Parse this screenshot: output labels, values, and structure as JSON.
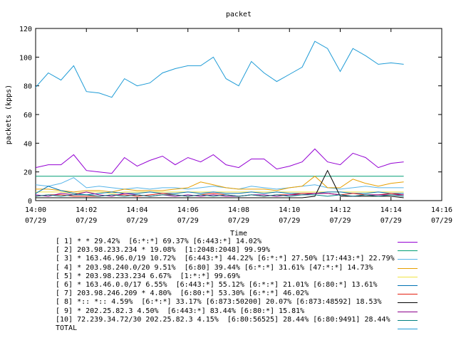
{
  "chart_data": {
    "type": "line",
    "title": "packet",
    "xlabel": "Time",
    "ylabel": "packets (kpps)",
    "ylim": [
      0,
      120
    ],
    "yticks": [
      "0",
      "20",
      "40",
      "60",
      "80",
      "100",
      "120"
    ],
    "xticks": [
      {
        "time": "14:00",
        "date": "07/29"
      },
      {
        "time": "14:02",
        "date": "07/29"
      },
      {
        "time": "14:04",
        "date": "07/29"
      },
      {
        "time": "14:06",
        "date": "07/29"
      },
      {
        "time": "14:08",
        "date": "07/29"
      },
      {
        "time": "14:10",
        "date": "07/29"
      },
      {
        "time": "14:12",
        "date": "07/29"
      },
      {
        "time": "14:14",
        "date": "07/29"
      },
      {
        "time": "14:16",
        "date": "07/29"
      }
    ],
    "x": [
      "14:00",
      "14:00:30",
      "14:01",
      "14:01:30",
      "14:02",
      "14:02:30",
      "14:03",
      "14:03:30",
      "14:04",
      "14:04:30",
      "14:05",
      "14:05:30",
      "14:06",
      "14:06:30",
      "14:07",
      "14:07:30",
      "14:08",
      "14:08:30",
      "14:09",
      "14:09:30",
      "14:10",
      "14:10:30",
      "14:11",
      "14:11:30",
      "14:12",
      "14:12:30",
      "14:13",
      "14:13:30",
      "14:14",
      "14:14:30"
    ],
    "grid": false,
    "legend_position": "bottom",
    "series": [
      {
        "name": "[ 1] * * 29.42%  [6:*:*] 69.37% [6:443:*] 14.02%",
        "color": "#9400d3",
        "values": [
          23,
          25,
          25,
          32,
          21,
          20,
          19,
          30,
          24,
          28,
          31,
          25,
          30,
          27,
          32,
          25,
          23,
          29,
          29,
          22,
          24,
          27,
          36,
          27,
          25,
          33,
          30,
          23,
          26,
          27
        ]
      },
      {
        "name": "[ 2] 203.98.233.234 * 19.08%  [1:2048:2048] 99.99%",
        "color": "#009e73",
        "values": [
          17,
          17,
          17,
          17,
          17,
          17,
          17,
          17,
          17,
          17,
          17,
          17,
          17,
          17,
          17,
          17,
          17,
          17,
          17,
          17,
          17,
          17,
          17,
          17,
          17,
          17,
          17,
          17,
          17,
          17
        ]
      },
      {
        "name": "[ 3] * 163.46.96.0/19 10.72%  [6:443:*] 44.22% [6:*:*] 27.50% [17:443:*] 22.79%",
        "color": "#56b4e9",
        "values": [
          11,
          10,
          12,
          16,
          9,
          10,
          9,
          8,
          9,
          8,
          9,
          9,
          8,
          9,
          10,
          9,
          8,
          10,
          9,
          8,
          9,
          10,
          11,
          9,
          8,
          9,
          10,
          9,
          9,
          9
        ]
      },
      {
        "name": "[ 4] * 203.98.240.0/20 9.51%  [6:80] 39.44% [6:*:*] 31.61% [47:*:*] 14.73%",
        "color": "#e69f00",
        "values": [
          8,
          8,
          7,
          6,
          7,
          7,
          6,
          8,
          7,
          7,
          7,
          8,
          9,
          13,
          11,
          9,
          8,
          8,
          8,
          7,
          9,
          10,
          17,
          9,
          9,
          15,
          12,
          10,
          12,
          13
        ]
      },
      {
        "name": "[ 5] * 203.98.233.234 6.67%  [1:*:*] 99.69%",
        "color": "#f0e442",
        "values": [
          6,
          6,
          6,
          5,
          6,
          6,
          5,
          6,
          6,
          6,
          6,
          6,
          6,
          6,
          6,
          6,
          6,
          6,
          6,
          6,
          6,
          6,
          6,
          6,
          6,
          6,
          6,
          6,
          6,
          6
        ]
      },
      {
        "name": "[ 6] * 163.46.0.0/17 6.55%  [6:443:*] 55.12% [6:*:*] 21.01% [6:80:*] 13.61%",
        "color": "#0072b2",
        "values": [
          5,
          10,
          7,
          5,
          4,
          5,
          6,
          5,
          5,
          6,
          5,
          5,
          6,
          5,
          6,
          5,
          5,
          6,
          5,
          6,
          5,
          5,
          5,
          6,
          6,
          5,
          5,
          6,
          5,
          5
        ]
      },
      {
        "name": "[ 7] 203.98.246.209 * 4.80%  [6:80:*] 53.30% [6:*:*] 46.02%",
        "color": "#e51e10",
        "values": [
          3,
          4,
          4,
          3,
          3,
          3,
          4,
          4,
          3,
          4,
          5,
          4,
          3,
          4,
          5,
          4,
          3,
          4,
          3,
          4,
          4,
          5,
          5,
          5,
          4,
          5,
          4,
          4,
          5,
          4
        ]
      },
      {
        "name": "[ 8] *:: *:: 4.59%  [6:*:*] 33.17% [6:873:50200] 20.07% [6:873:48592] 18.53%",
        "color": "#000000",
        "values": [
          2,
          2,
          2,
          2,
          2,
          2,
          2,
          2,
          2,
          2,
          2,
          2,
          2,
          2,
          2,
          2,
          2,
          2,
          2,
          2,
          2,
          2,
          3,
          21,
          3,
          3,
          3,
          3,
          3,
          2
        ]
      },
      {
        "name": "[ 9] * 202.25.82.3 4.50%  [6:443:*] 83.44% [6:80:*] 15.81%",
        "color": "#8b008b",
        "values": [
          4,
          3,
          5,
          4,
          6,
          4,
          3,
          5,
          4,
          3,
          4,
          3,
          4,
          3,
          4,
          3,
          3,
          4,
          4,
          3,
          4,
          4,
          5,
          5,
          4,
          3,
          4,
          4,
          4,
          4
        ]
      },
      {
        "name": "[10] 72.239.34.72/30 202.25.82.3 4.15%  [6:80:56525] 28.44% [6:80:9491] 28.44%",
        "color": "#008080",
        "values": [
          3,
          4,
          3,
          4,
          4,
          3,
          4,
          3,
          4,
          3,
          4,
          4,
          3,
          4,
          3,
          4,
          3,
          4,
          3,
          4,
          3,
          4,
          4,
          3,
          4,
          3,
          4,
          3,
          4,
          3
        ]
      },
      {
        "name": "TOTAL",
        "color": "#1e9bd6",
        "values": [
          79,
          89,
          84,
          94,
          76,
          75,
          72,
          85,
          80,
          82,
          89,
          92,
          94,
          94,
          100,
          85,
          80,
          97,
          89,
          83,
          88,
          93,
          111,
          106,
          90,
          106,
          101,
          95,
          96,
          95
        ]
      }
    ]
  }
}
